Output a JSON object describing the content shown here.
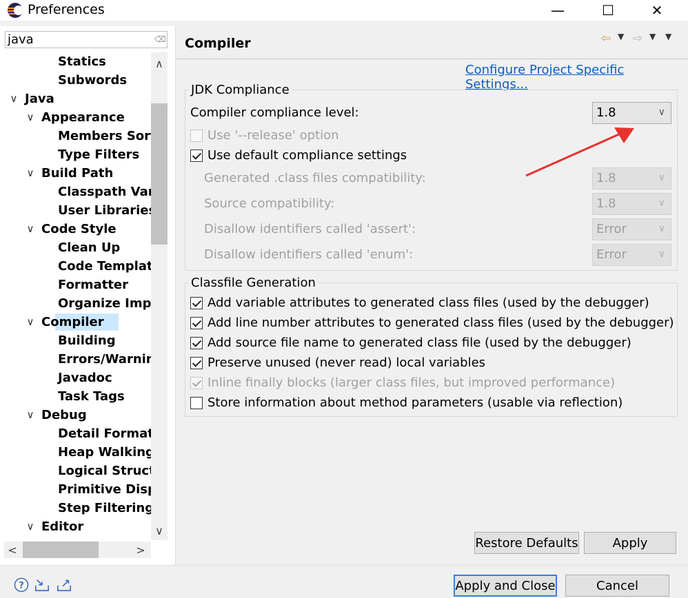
{
  "window": {
    "title": "Preferences",
    "minimize_glyph": "—",
    "maximize_glyph": "☐",
    "close_glyph": "✕"
  },
  "filter": {
    "value": "java",
    "clear_icon": "eraser-icon"
  },
  "tree": {
    "items": [
      {
        "label": "Statics",
        "level": 2,
        "expander": ""
      },
      {
        "label": "Subwords",
        "level": 2,
        "expander": ""
      },
      {
        "label": "Java",
        "level": 0,
        "expander": "∨"
      },
      {
        "label": "Appearance",
        "level": 1,
        "expander": "∨"
      },
      {
        "label": "Members Sort",
        "level": 2,
        "expander": ""
      },
      {
        "label": "Type Filters",
        "level": 2,
        "expander": ""
      },
      {
        "label": "Build Path",
        "level": 1,
        "expander": "∨"
      },
      {
        "label": "Classpath Varia",
        "level": 2,
        "expander": ""
      },
      {
        "label": "User Libraries",
        "level": 2,
        "expander": ""
      },
      {
        "label": "Code Style",
        "level": 1,
        "expander": "∨"
      },
      {
        "label": "Clean Up",
        "level": 2,
        "expander": ""
      },
      {
        "label": "Code Template",
        "level": 2,
        "expander": ""
      },
      {
        "label": "Formatter",
        "level": 2,
        "expander": ""
      },
      {
        "label": "Organize Impo",
        "level": 2,
        "expander": ""
      },
      {
        "label": "Compiler",
        "level": 1,
        "expander": "∨",
        "selected": true
      },
      {
        "label": "Building",
        "level": 2,
        "expander": ""
      },
      {
        "label": "Errors/Warning",
        "level": 2,
        "expander": ""
      },
      {
        "label": "Javadoc",
        "level": 2,
        "expander": ""
      },
      {
        "label": "Task Tags",
        "level": 2,
        "expander": ""
      },
      {
        "label": "Debug",
        "level": 1,
        "expander": "∨"
      },
      {
        "label": "Detail Formatte",
        "level": 2,
        "expander": ""
      },
      {
        "label": "Heap Walking",
        "level": 2,
        "expander": ""
      },
      {
        "label": "Logical Structu",
        "level": 2,
        "expander": ""
      },
      {
        "label": "Primitive Displa",
        "level": 2,
        "expander": ""
      },
      {
        "label": "Step Filtering",
        "level": 2,
        "expander": ""
      },
      {
        "label": "Editor",
        "level": 1,
        "expander": "∨"
      }
    ],
    "scroll_up_glyph": "∧",
    "scroll_down_glyph": "∨",
    "scroll_left_glyph": "<",
    "scroll_right_glyph": ">"
  },
  "page": {
    "title": "Compiler",
    "configure_link": "Configure Project Specific Settings...",
    "nav": {
      "back_icon": "back-arrow-icon",
      "forward_icon": "forward-arrow-icon",
      "back_glyph": "⇦",
      "forward_glyph": "⇨",
      "drop_glyph": "▼",
      "menu_glyph": "▼"
    }
  },
  "jdk": {
    "group_label": "JDK Compliance",
    "compliance_label": "Compiler compliance level:",
    "compliance_value": "1.8",
    "release_label": "Use '--release' option",
    "release_checked": false,
    "default_label": "Use default compliance settings",
    "default_checked": true,
    "rows": [
      {
        "label": "Generated .class files compatibility:",
        "value": "1.8"
      },
      {
        "label": "Source compatibility:",
        "value": "1.8"
      },
      {
        "label": "Disallow identifiers called 'assert':",
        "value": "Error"
      },
      {
        "label": "Disallow identifiers called 'enum':",
        "value": "Error"
      }
    ],
    "chevron_glyph": "∨"
  },
  "classfile": {
    "group_label": "Classfile Generation",
    "options": [
      {
        "label": "Add variable attributes to generated class files (used by the debugger)",
        "checked": true,
        "disabled": false
      },
      {
        "label": "Add line number attributes to generated class files (used by the debugger)",
        "checked": true,
        "disabled": false
      },
      {
        "label": "Add source file name to generated class file (used by the debugger)",
        "checked": true,
        "disabled": false
      },
      {
        "label": "Preserve unused (never read) local variables",
        "checked": true,
        "disabled": false
      },
      {
        "label": "Inline finally blocks (larger class files, but improved performance)",
        "checked": true,
        "disabled": true
      },
      {
        "label": "Store information about method parameters (usable via reflection)",
        "checked": false,
        "disabled": false
      }
    ]
  },
  "buttons": {
    "restore_defaults": "Restore Defaults",
    "apply": "Apply",
    "apply_and_close": "Apply and Close",
    "cancel": "Cancel"
  },
  "footer_icons": [
    "help-icon",
    "import-icon",
    "export-icon"
  ],
  "colors": {
    "selection": "#cce8ff",
    "link": "#0a5ec2",
    "annotation_arrow": "#e8322d",
    "default_button_border": "#3c7fd3"
  }
}
